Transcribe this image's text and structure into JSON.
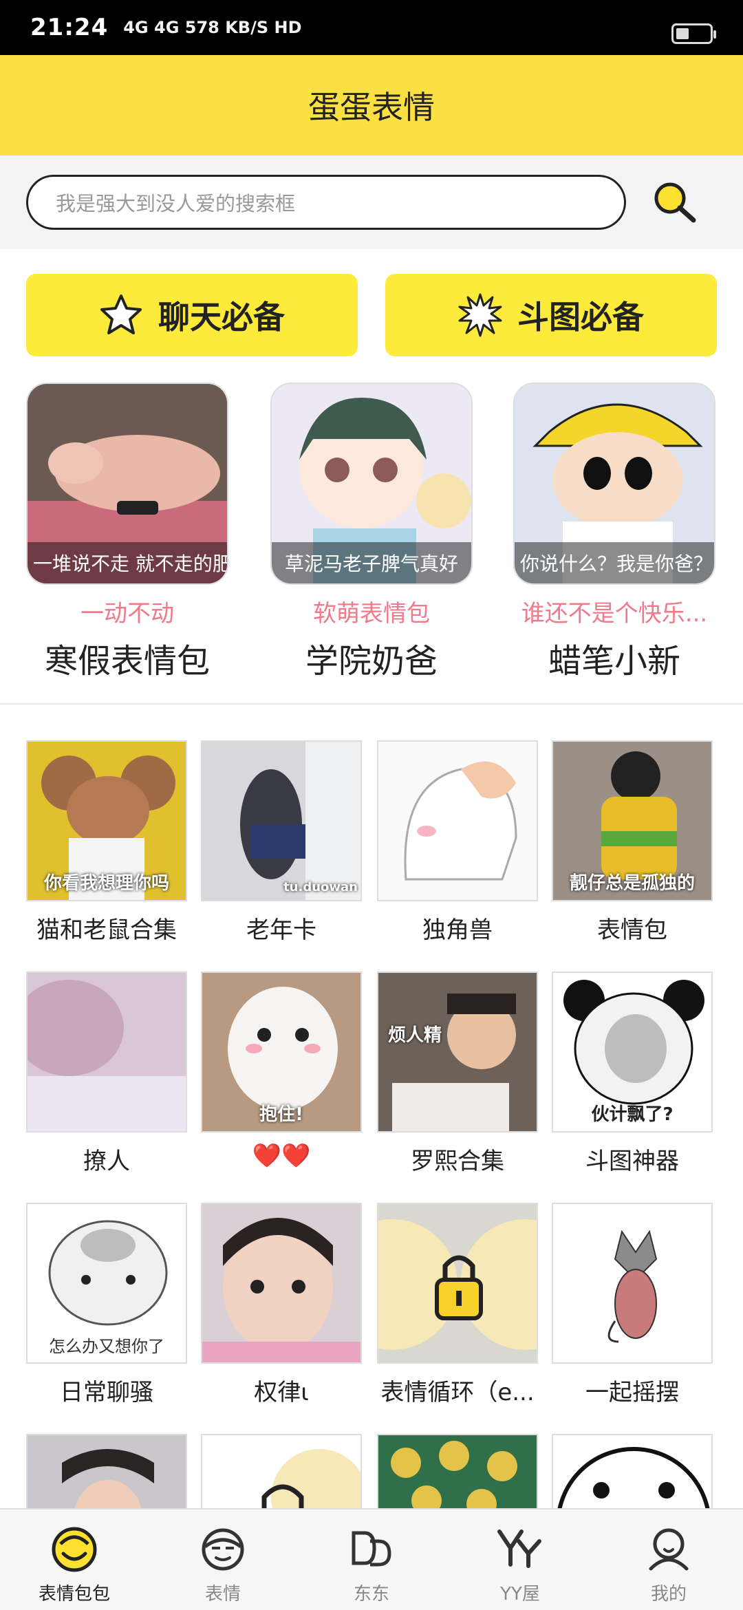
{
  "status_bar": {
    "time": "21:24",
    "network": "4G 4G 578 KB/S HD"
  },
  "app_bar": {
    "title": "蛋蛋表情"
  },
  "search": {
    "placeholder": "我是强大到没人爱的搜索框"
  },
  "quick_buttons": [
    {
      "label": "聊天必备",
      "icon": "star-icon"
    },
    {
      "label": "斗图必备",
      "icon": "burst-icon"
    }
  ],
  "featured": [
    {
      "caption": "一堆说不走 就不走的肥肉",
      "subtitle": "一动不动",
      "name": "寒假表情包"
    },
    {
      "caption": "草泥马老子脾气真好",
      "subtitle": "软萌表情包",
      "name": "学院奶爸"
    },
    {
      "caption": "你说什么？我是你爸？",
      "subtitle": "谁还不是个快乐...",
      "name": "蜡笔小新"
    }
  ],
  "grid": [
    {
      "label": "猫和老鼠合集",
      "caption": "你看我想理你吗"
    },
    {
      "label": "老年卡",
      "caption": "tu.duowan"
    },
    {
      "label": "独角兽",
      "caption": ""
    },
    {
      "label": "表情包",
      "caption": "靓仔总是孤独的"
    },
    {
      "label": "撩人",
      "caption": ""
    },
    {
      "label": "❤️❤️",
      "caption": "抱住!"
    },
    {
      "label": "罗熙合集",
      "caption": "烦人精"
    },
    {
      "label": "斗图神器",
      "caption": "伙计飘了?"
    },
    {
      "label": "日常聊骚",
      "caption": "怎么办又想你了"
    },
    {
      "label": "权律ι",
      "caption": ""
    },
    {
      "label": "表情循环（e...",
      "caption": ""
    },
    {
      "label": "一起摇摆",
      "caption": ""
    },
    {
      "label": "",
      "caption": ""
    },
    {
      "label": "",
      "caption": ""
    },
    {
      "label": "",
      "caption": ""
    },
    {
      "label": "",
      "caption": ""
    }
  ],
  "bottom_nav": [
    {
      "label": "表情包包",
      "icon": "smiley-tab-icon",
      "active": true
    },
    {
      "label": "表情",
      "icon": "face-tab-icon",
      "active": false
    },
    {
      "label": "东东",
      "icon": "dd-tab-icon",
      "active": false
    },
    {
      "label": "YY屋",
      "icon": "yy-tab-icon",
      "active": false
    },
    {
      "label": "我的",
      "icon": "profile-tab-icon",
      "active": false
    }
  ],
  "colors": {
    "brand_yellow": "#fbe044",
    "button_yellow": "#fdeb3b",
    "subtitle_pink": "#f07a8a"
  }
}
